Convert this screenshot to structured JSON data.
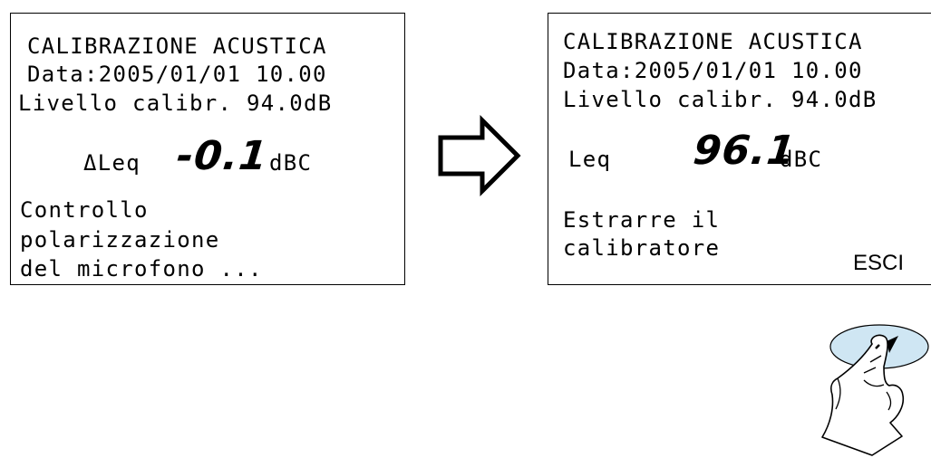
{
  "left_screen": {
    "title": "CALIBRAZIONE ACUSTICA",
    "date_line": "Data:2005/01/01 10.00",
    "level_line": "Livello calibr. 94.0dB",
    "measure_label": "ΔLeq",
    "measure_value": "-0.1",
    "measure_unit": "dBC",
    "message_lines": [
      "Controllo",
      "polarizzazione",
      "del microfono ..."
    ]
  },
  "right_screen": {
    "title": "CALIBRAZIONE ACUSTICA",
    "date_line": "Data:2005/01/01 10.00",
    "level_line": "Livello calibr. 94.0dB",
    "measure_label": "Leq",
    "measure_value": "96.1",
    "measure_unit": "dBC",
    "message_lines": [
      "Estrarre il",
      "calibratore"
    ],
    "softkey_label": "ESCI"
  },
  "icons": {
    "transition": "right-arrow-icon",
    "press": "finger-press-icon"
  }
}
